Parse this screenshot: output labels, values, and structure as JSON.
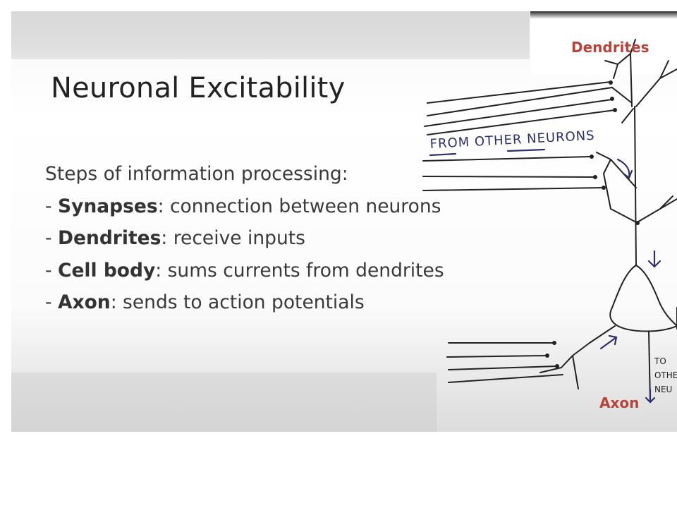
{
  "slide": {
    "title": "Neuronal Excitability",
    "intro": "Steps of information processing:",
    "items": [
      {
        "dash": "- ",
        "term": "Synapses",
        "desc": ": connection between neurons"
      },
      {
        "dash": "- ",
        "term": "Dendrites",
        "desc": ": receive inputs"
      },
      {
        "dash": "- ",
        "term": "Cell body",
        "desc": ": sums currents from dendrites"
      },
      {
        "dash": "- ",
        "term": "Axon",
        "desc": ": sends to action potentials"
      }
    ]
  },
  "diagram": {
    "label_dendrites": "Dendrites",
    "label_axon": "Axon",
    "note_from": "FROM OTHER NEURONS",
    "note_to_1": "TO",
    "note_to_2": "OTHER",
    "note_to_3": "NEU",
    "label_color": "#b5453a",
    "ink_color": "#2b2f6b"
  }
}
